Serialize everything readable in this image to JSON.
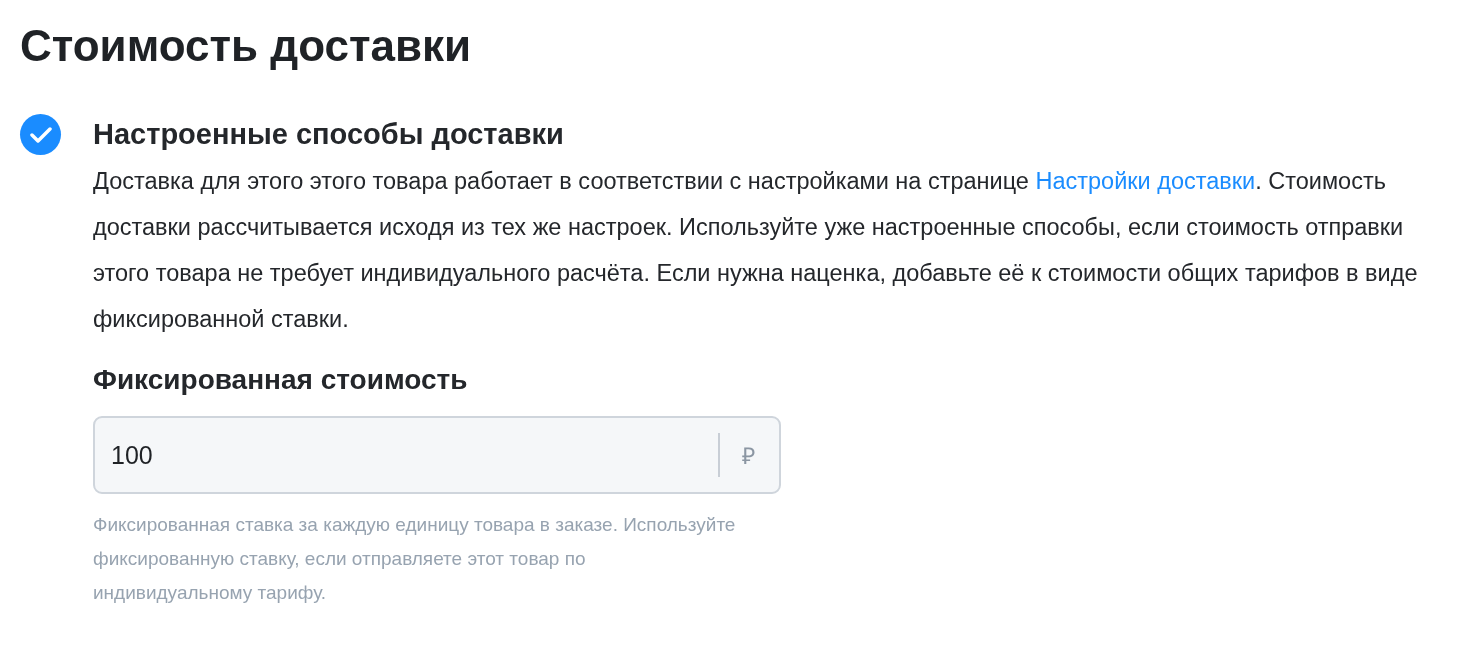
{
  "title": "Стоимость доставки",
  "option": {
    "checked": true,
    "label": "Настроенные способы доставки",
    "description": {
      "before": "Доставка для этого этого товара работает в соответствии с настройками на странице ",
      "link": "Настройки доставки",
      "after": ". Стоимость доставки рассчитывается исходя из тех же настроек. Используйте уже настроенные способы, если стоимость отправки этого товара не требует индивидуального расчёта. Если нужна наценка, добавьте её к стоимости общих тарифов в виде фиксированной ставки."
    }
  },
  "field": {
    "label": "Фиксированная стоимость",
    "value": "100",
    "suffix": "₽",
    "hint": "Фиксированная ставка за каждую единицу товара в заказе. Используйте фиксированную ставку, если отправляете этот товар по индивидуальному тарифу."
  }
}
